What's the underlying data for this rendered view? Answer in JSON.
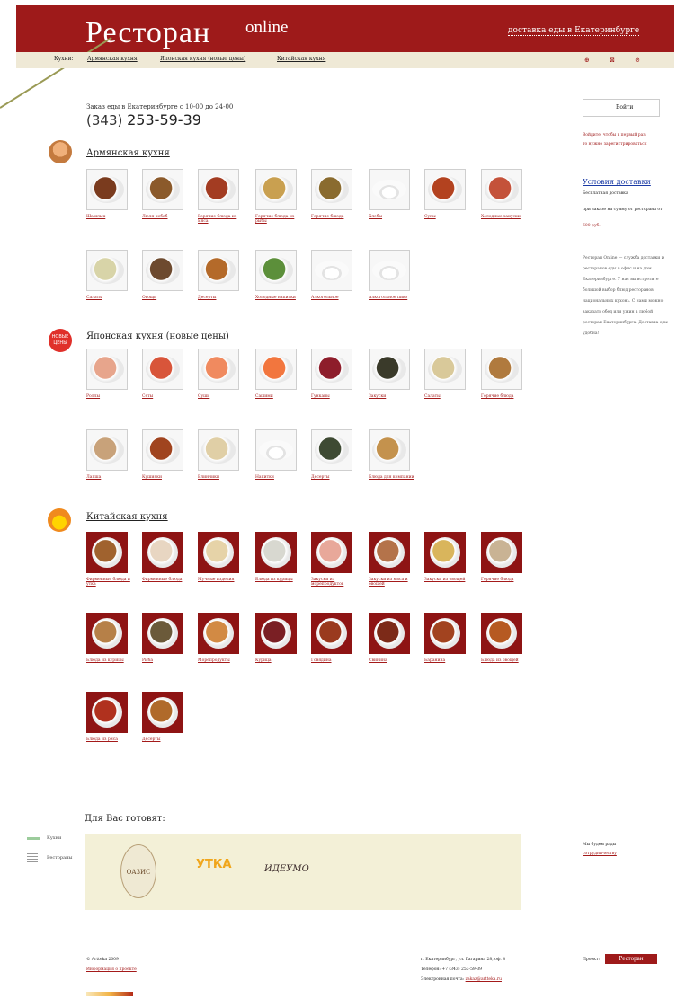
{
  "header": {
    "logo_main": "Ресторан",
    "logo_sub": "online",
    "delivery": "доставка еды в Екатеринбурге"
  },
  "nav": {
    "label": "Кухни:",
    "links": [
      "Армянская кухня",
      "Японская кухня (новые цены)",
      "Китайская кухня"
    ],
    "icons": [
      "⊕",
      "⊠",
      "⊘"
    ]
  },
  "order": {
    "text": "Заказ еды в Екатеринбурге с 10-00 до 24-00",
    "phone_code": "(343)",
    "phone_number": "253-59-39"
  },
  "sections": [
    {
      "title": "Армянская кухня",
      "rows": [
        [
          {
            "caption": "Шашлык",
            "color": "#7a3b1e"
          },
          {
            "caption": "Люля-кебаб",
            "color": "#8b5a2b"
          },
          {
            "caption": "Горячие блюда из мяса",
            "color": "#a33c22"
          },
          {
            "caption": "Горячие блюда из рыбы",
            "color": "#c9a050"
          },
          {
            "caption": "Горячие блюда",
            "color": "#8a6b2f"
          },
          {
            "caption": "Хлебы",
            "color": "",
            "empty": true
          },
          {
            "caption": "Супы",
            "color": "#b3421f"
          },
          {
            "caption": "Холодные закуски",
            "color": "#c4523a"
          }
        ],
        [
          {
            "caption": "Салаты",
            "color": "#d8d4a8"
          },
          {
            "caption": "Овощи",
            "color": "#6d4a2f"
          },
          {
            "caption": "Десерты",
            "color": "#b46a2a"
          },
          {
            "caption": "Холодные напитки",
            "color": "#5c8f3a"
          },
          {
            "caption": "Алкогольное",
            "color": "",
            "empty": true
          },
          {
            "caption": "Алкогольное пиво",
            "color": "",
            "empty": true
          }
        ]
      ]
    },
    {
      "title": "Японская кухня (новые цены)",
      "badge": "НОВЫЕ ЦЕНЫ",
      "rows": [
        [
          {
            "caption": "Роллы",
            "color": "#e7a58c"
          },
          {
            "caption": "Сеты",
            "color": "#d8553a"
          },
          {
            "caption": "Суши",
            "color": "#f08a5f"
          },
          {
            "caption": "Сашими",
            "color": "#f2763e"
          },
          {
            "caption": "Гунканы",
            "color": "#8e1d2b"
          },
          {
            "caption": "Закуски",
            "color": "#3a3a2a"
          },
          {
            "caption": "Салаты",
            "color": "#d9c99a"
          },
          {
            "caption": "Горячие блюда",
            "color": "#b07a3e"
          }
        ],
        [
          {
            "caption": "Лапша",
            "color": "#c8a27a"
          },
          {
            "caption": "Кушияки",
            "color": "#a0441f"
          },
          {
            "caption": "Блинчики",
            "color": "#e0cfa6"
          },
          {
            "caption": "Напитки",
            "color": "",
            "empty": true
          },
          {
            "caption": "Десерты",
            "color": "#3e4a33"
          },
          {
            "caption": "Блюда для компании",
            "color": "#c4924d"
          }
        ]
      ]
    },
    {
      "title": "Китайская кухня",
      "rows": [
        [
          {
            "caption": "Фирменные блюда и утка",
            "color": "#a0622e"
          },
          {
            "caption": "Фирменные блюда",
            "color": "#e8d6c2"
          },
          {
            "caption": "Мучные изделия",
            "color": "#e6d3a8"
          },
          {
            "caption": "Блюда из курицы",
            "color": "#d8d8d0"
          },
          {
            "caption": "Закуски из морепродуктов",
            "color": "#e8a89a"
          },
          {
            "caption": "Закуски из мяса и овощей",
            "color": "#b4734a"
          },
          {
            "caption": "Закуски из овощей",
            "color": "#d9b55c"
          },
          {
            "caption": "Горячие блюда",
            "color": "#c9b394"
          }
        ],
        [
          {
            "caption": "Блюда из курицы",
            "color": "#b68048"
          },
          {
            "caption": "Рыба",
            "color": "#6b5a3a"
          },
          {
            "caption": "Морепродукты",
            "color": "#d28a44"
          },
          {
            "caption": "Курица",
            "color": "#7a1f24"
          },
          {
            "caption": "Говядина",
            "color": "#9a3a1e"
          },
          {
            "caption": "Свинина",
            "color": "#7c2a18"
          },
          {
            "caption": "Баранина",
            "color": "#a2431f"
          },
          {
            "caption": "Блюда из овощей",
            "color": "#b65a22"
          }
        ],
        [
          {
            "caption": "Блюда из риса",
            "color": "#b0311e"
          },
          {
            "caption": "Десерты",
            "color": "#b06a2a"
          }
        ]
      ]
    }
  ],
  "sidebar": {
    "login": "Войти",
    "login_note_1": "Войдите, чтобы в первый раз",
    "login_note_2_prefix": "то нужно",
    "register_link": "зарегистрироваться",
    "delivery_head": "Условия доставки",
    "delivery_line_1": "Бесплатная доставка",
    "delivery_line_2": "при заказе на сумму от ресторана от",
    "delivery_line_3": "600 руб.",
    "about": "Ресторан Online — служба доставки и ресторанов еды в офис и на дом Екатеринбурге. У нас вы встретите большой выбор блюд ресторанов национальных кухонь. С нами можно заказать обед или ужин в любой ресторан Екатеринбурга. Доставка еды удобна!"
  },
  "cooks": {
    "title": "Для Вас готовят:",
    "partners": [
      "ОАЗИС",
      "УТКА",
      "ИДЕУМО"
    ]
  },
  "legend": [
    {
      "label": "Кухни"
    },
    {
      "label": "Рестораны"
    }
  ],
  "partners_side": {
    "line_1": "Мы будем рады",
    "link": "сотрудничеству"
  },
  "footer": {
    "copyright": "© Artteka 2009",
    "privacy_link": "Информация о проекте",
    "address": "г. Екатеринбург, ул. Гагарина 28, оф. 4",
    "phone": "Телефон: +7 (343) 253-59-39",
    "email_prefix": "Электронная почта:",
    "email_link": "zakaz@artteka.ru",
    "project_label": "Проект:",
    "project_badge": "Ресторан"
  }
}
